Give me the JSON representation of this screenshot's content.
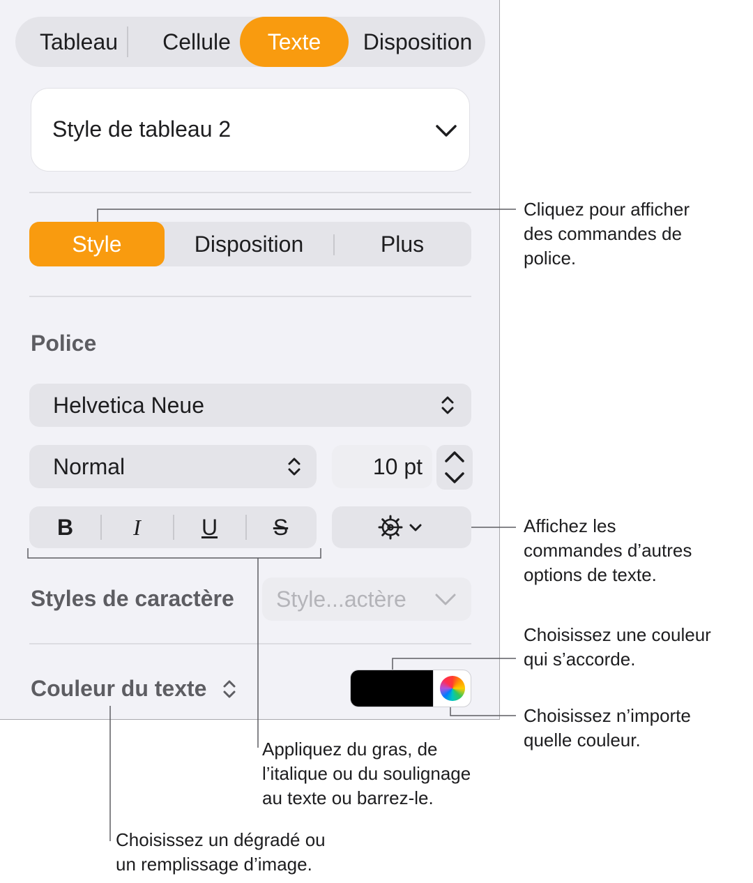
{
  "top_tabs": [
    "Tableau",
    "Cellule",
    "Texte",
    "Disposition"
  ],
  "style_dropdown": {
    "value": "Style de tableau 2",
    "icon": "chevron-down-icon"
  },
  "sub_tabs": [
    "Style",
    "Disposition",
    "Plus"
  ],
  "font_section": {
    "heading": "Police",
    "family": "Helvetica Neue",
    "typeface": "Normal",
    "size": "10 pt"
  },
  "format_buttons": {
    "bold": "B",
    "italic": "I",
    "underline": "U",
    "strike": "S"
  },
  "char_styles": {
    "label": "Styles de caractère",
    "value": "Style...actère"
  },
  "text_color": {
    "label": "Couleur du texte",
    "swatch": "#000000"
  },
  "accent_color": "#f99b0f",
  "callouts": {
    "style_tab": [
      "Cliquez pour afficher",
      "des commandes de",
      "police."
    ],
    "advanced": [
      "Affichez les",
      "commandes d’autres",
      "options de texte."
    ],
    "swatch": [
      "Choisissez une couleur",
      "qui s’accorde."
    ],
    "color_wheel": [
      "Choisissez n’importe",
      "quelle couleur."
    ],
    "format": [
      "Appliquez du gras, de",
      "l’italique ou du soulignage",
      "au texte ou barrez-le."
    ],
    "fill": [
      "Choisissez un dégradé ou",
      "un remplissage d’image."
    ]
  }
}
